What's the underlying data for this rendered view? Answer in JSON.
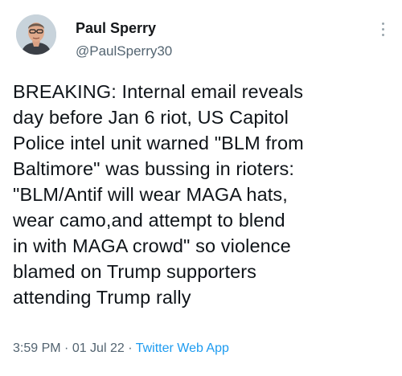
{
  "author": {
    "display_name": "Paul Sperry",
    "handle": "@PaulSperry30"
  },
  "tweet": {
    "lines": [
      "BREAKING: Internal email reveals",
      "day before Jan 6 riot, US Capitol",
      "Police intel unit warned \"BLM from",
      "Baltimore\" was bussing in rioters:",
      "\"BLM/Antif will wear MAGA hats,",
      "wear camo,and attempt to blend",
      "in with MAGA crowd\" so violence",
      "blamed on Trump supporters",
      "attending Trump rally"
    ]
  },
  "meta": {
    "time": "3:59 PM",
    "separator": " · ",
    "date": "01 Jul 22",
    "source": "Twitter Web App"
  },
  "colors": {
    "text": "#0f1419",
    "secondary": "#536471",
    "link": "#1d9bf0"
  },
  "icons": {
    "more": "vertical-ellipsis"
  }
}
